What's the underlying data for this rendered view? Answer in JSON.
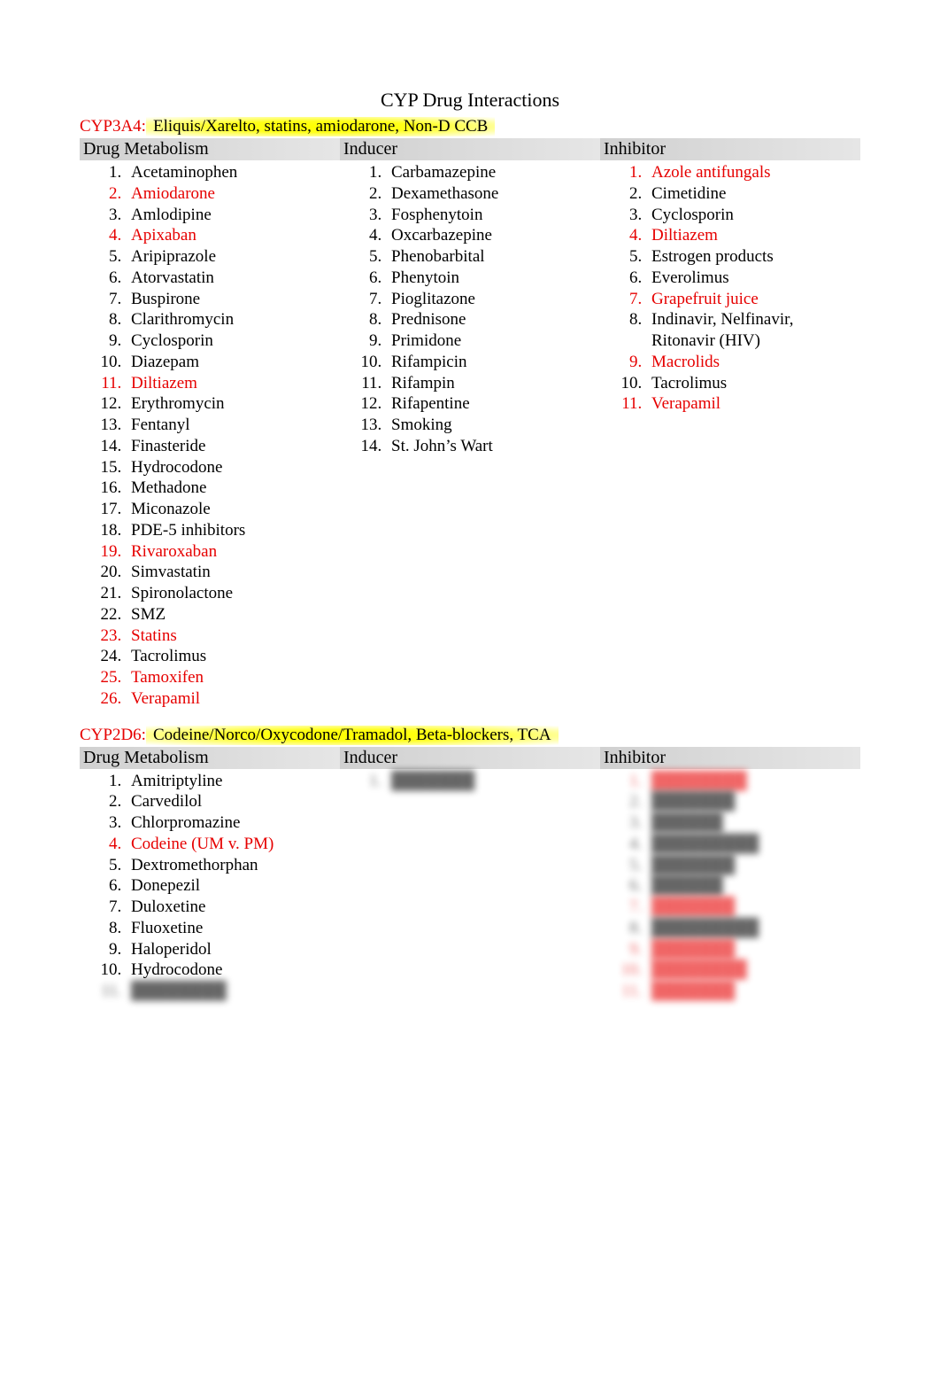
{
  "title": "CYP Drug Interactions",
  "sections": [
    {
      "enzyme": "CYP3A4",
      "highlight_summary": "Eliquis/Xarelto, statins, amiodarone, Non-D CCB",
      "columns": {
        "metabolism": {
          "header": "Drug Metabolism",
          "items": [
            {
              "t": "Acetaminophen",
              "r": false
            },
            {
              "t": "Amiodarone",
              "r": true
            },
            {
              "t": "Amlodipine",
              "r": false
            },
            {
              "t": "Apixaban",
              "r": true
            },
            {
              "t": "Aripiprazole",
              "r": false
            },
            {
              "t": "Atorvastatin",
              "r": false
            },
            {
              "t": "Buspirone",
              "r": false
            },
            {
              "t": "Clarithromycin",
              "r": false
            },
            {
              "t": "Cyclosporin",
              "r": false
            },
            {
              "t": "Diazepam",
              "r": false
            },
            {
              "t": "Diltiazem",
              "r": true
            },
            {
              "t": "Erythromycin",
              "r": false
            },
            {
              "t": "Fentanyl",
              "r": false
            },
            {
              "t": "Finasteride",
              "r": false
            },
            {
              "t": "Hydrocodone",
              "r": false
            },
            {
              "t": "Methadone",
              "r": false
            },
            {
              "t": "Miconazole",
              "r": false
            },
            {
              "t": "PDE-5 inhibitors",
              "r": false
            },
            {
              "t": "Rivaroxaban",
              "r": true
            },
            {
              "t": "Simvastatin",
              "r": false
            },
            {
              "t": "Spironolactone",
              "r": false
            },
            {
              "t": "SMZ",
              "r": false
            },
            {
              "t": "Statins",
              "r": true
            },
            {
              "t": "Tacrolimus",
              "r": false
            },
            {
              "t": "Tamoxifen",
              "r": true
            },
            {
              "t": "Verapamil",
              "r": true
            }
          ]
        },
        "inducer": {
          "header": "Inducer",
          "items": [
            {
              "t": "Carbamazepine",
              "r": false
            },
            {
              "t": "Dexamethasone",
              "r": false
            },
            {
              "t": "Fosphenytoin",
              "r": false
            },
            {
              "t": "Oxcarbazepine",
              "r": false
            },
            {
              "t": "Phenobarbital",
              "r": false
            },
            {
              "t": "Phenytoin",
              "r": false
            },
            {
              "t": "Pioglitazone",
              "r": false
            },
            {
              "t": "Prednisone",
              "r": false
            },
            {
              "t": "Primidone",
              "r": false
            },
            {
              "t": "Rifampicin",
              "r": false
            },
            {
              "t": "Rifampin",
              "r": false
            },
            {
              "t": "Rifapentine",
              "r": false
            },
            {
              "t": "Smoking",
              "r": false
            },
            {
              "t": "St. John’s Wart",
              "r": false
            }
          ]
        },
        "inhibitor": {
          "header": "Inhibitor",
          "items": [
            {
              "t": "Azole antifungals",
              "r": true
            },
            {
              "t": "Cimetidine",
              "r": false
            },
            {
              "t": "Cyclosporin",
              "r": false
            },
            {
              "t": "Diltiazem",
              "r": true
            },
            {
              "t": "Estrogen products",
              "r": false
            },
            {
              "t": "Everolimus",
              "r": false
            },
            {
              "t": "Grapefruit juice",
              "r": true
            },
            {
              "t": "Indinavir, Nelfinavir, Ritonavir (HIV)",
              "r": false
            },
            {
              "t": "Macrolids",
              "r": true
            },
            {
              "t": "Tacrolimus",
              "r": false
            },
            {
              "t": "Verapamil",
              "r": true
            }
          ]
        }
      }
    },
    {
      "enzyme": "CYP2D6",
      "highlight_summary": "Codeine/Norco/Oxycodone/Tramadol, Beta-blockers, TCA",
      "columns": {
        "metabolism": {
          "header": "Drug Metabolism",
          "items": [
            {
              "t": "Amitriptyline",
              "r": false
            },
            {
              "t": "Carvedilol",
              "r": false
            },
            {
              "t": "Chlorpromazine",
              "r": false
            },
            {
              "t": "Codeine (UM v. PM)",
              "r": true
            },
            {
              "t": "Dextromethorphan",
              "r": false
            },
            {
              "t": "Donepezil",
              "r": false
            },
            {
              "t": "Duloxetine",
              "r": false
            },
            {
              "t": "Fluoxetine",
              "r": false
            },
            {
              "t": "Haloperidol",
              "r": false
            },
            {
              "t": "Hydrocodone",
              "r": false
            },
            {
              "t": "████████",
              "r": false,
              "blur": true
            }
          ]
        },
        "inducer": {
          "header": "Inducer",
          "items": [
            {
              "t": "███████",
              "r": false,
              "blur": true
            }
          ]
        },
        "inhibitor": {
          "header": "Inhibitor",
          "items": [
            {
              "t": "████████",
              "r": true,
              "blur": true
            },
            {
              "t": "███████",
              "r": false,
              "blur": true
            },
            {
              "t": "██████",
              "r": false,
              "blur": true
            },
            {
              "t": "█████████",
              "r": false,
              "blur": true
            },
            {
              "t": "███████",
              "r": false,
              "blur": true
            },
            {
              "t": "██████",
              "r": false,
              "blur": true
            },
            {
              "t": "███████",
              "r": true,
              "blur": true
            },
            {
              "t": "█████████",
              "r": false,
              "blur": true
            },
            {
              "t": "███████",
              "r": true,
              "blur": true
            },
            {
              "t": "████████",
              "r": true,
              "blur": true
            },
            {
              "t": "███████",
              "r": true,
              "blur": true
            }
          ]
        }
      }
    }
  ]
}
